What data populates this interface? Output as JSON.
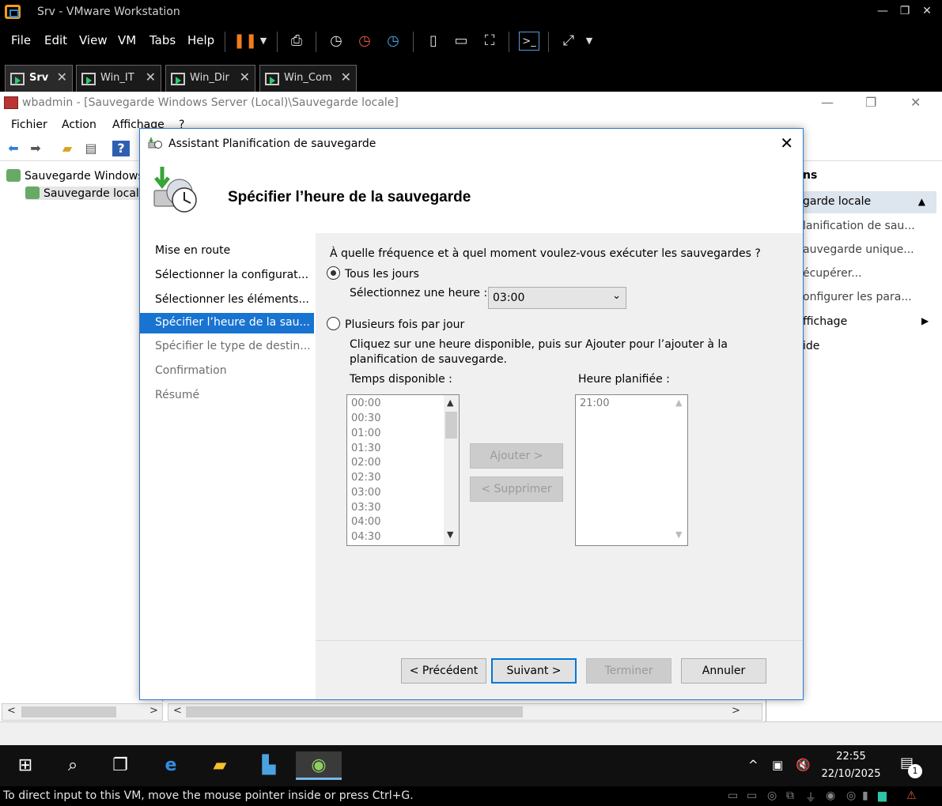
{
  "host": {
    "title": "Srv - VMware Workstation",
    "menu": {
      "file": "File",
      "edit": "Edit",
      "view": "View",
      "vm": "VM",
      "tabs": "Tabs",
      "help": "Help"
    },
    "tabs": [
      {
        "label": "Srv",
        "active": true
      },
      {
        "label": "Win_IT"
      },
      {
        "label": "Win_Dir"
      },
      {
        "label": "Win_Com"
      }
    ],
    "status_message": "To direct input to this VM, move the mouse pointer inside or press Ctrl+G."
  },
  "mmc": {
    "title": "wbadmin - [Sauvegarde Windows Server (Local)\\Sauvegarde locale]",
    "menu": {
      "fichier": "Fichier",
      "action": "Action",
      "affichage": "Affichage",
      "help": "?"
    },
    "tree": {
      "root": "Sauvegarde Windows",
      "child": "Sauvegarde locale"
    },
    "actions": {
      "header": "ns",
      "group": "garde locale",
      "items": [
        "lanification de sau...",
        "auvegarde unique...",
        "écupérer...",
        "onfigurer les para...",
        "ffichage",
        "ide"
      ]
    }
  },
  "wizard": {
    "title": "Assistant Planification de sauvegarde",
    "heading": "Spécifier l’heure de la sauvegarde",
    "steps": [
      {
        "label": "Mise en route",
        "state": "done"
      },
      {
        "label": "Sélectionner la configurat...",
        "state": "done"
      },
      {
        "label": "Sélectionner les éléments...",
        "state": "done"
      },
      {
        "label": "Spécifier l’heure de la sau...",
        "state": "active"
      },
      {
        "label": "Spécifier le type de destin...",
        "state": "disabled"
      },
      {
        "label": "Confirmation",
        "state": "disabled"
      },
      {
        "label": "Résumé",
        "state": "disabled"
      }
    ],
    "question": "À quelle fréquence et à quel moment voulez-vous exécuter les sauvegardes ?",
    "option_daily": "Tous les jours",
    "select_time_label": "Sélectionnez une heure :",
    "select_time_value": "03:00",
    "option_multiple": "Plusieurs fois par jour",
    "multiple_description": "Cliquez sur une heure disponible, puis sur Ajouter pour l’ajouter à la planification de sauvegarde.",
    "available_label": "Temps disponible :",
    "available_times": [
      "00:00",
      "00:30",
      "01:00",
      "01:30",
      "02:00",
      "02:30",
      "03:00",
      "03:30",
      "04:00",
      "04:30"
    ],
    "scheduled_label": "Heure planifiée :",
    "scheduled_times": [
      "21:00"
    ],
    "add_button": "Ajouter >",
    "remove_button": "< Supprimer",
    "buttons": {
      "previous": "< Précédent",
      "next": "Suivant >",
      "finish": "Terminer",
      "cancel": "Annuler"
    }
  },
  "taskbar": {
    "time": "22:55",
    "date": "22/10/2025",
    "notification_count": "1"
  }
}
